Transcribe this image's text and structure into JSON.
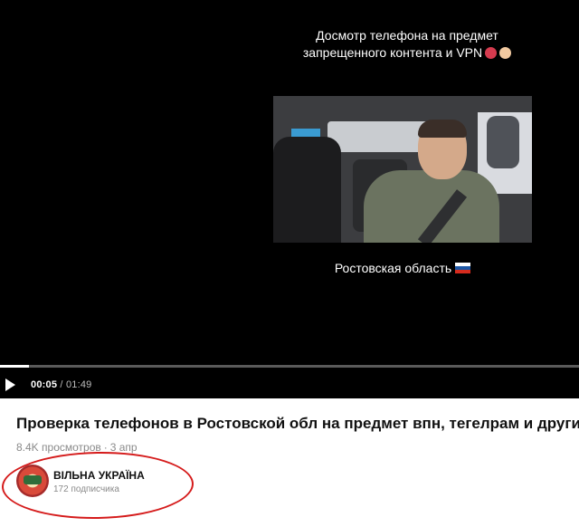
{
  "video": {
    "overlay_title_line1": "Досмотр телефона на предмет",
    "overlay_title_line2": "запрещенного контента и VPN",
    "overlay_emojis": [
      "angry-face-emoji",
      "exploding-head-emoji"
    ],
    "region_caption": "Ростовская область",
    "flag_icon": "russia-flag-icon",
    "flag_colors": [
      "#ffffff",
      "#1c57a5",
      "#d52b1e"
    ],
    "progress": 0.05
  },
  "controls": {
    "play_icon": "play-icon",
    "current_time": "00:05",
    "separator": "/",
    "duration": "01:49"
  },
  "info": {
    "title": "Проверка телефонов в Ростовской обл на предмет впн, тегелрам и других",
    "views": "8.4K просмотров",
    "dot": "·",
    "date": "3 апр"
  },
  "channel": {
    "name": "ВІЛЬНА УКРАЇНА",
    "subscribers": "172 подписчика",
    "annotation_color": "#d51b1b"
  }
}
